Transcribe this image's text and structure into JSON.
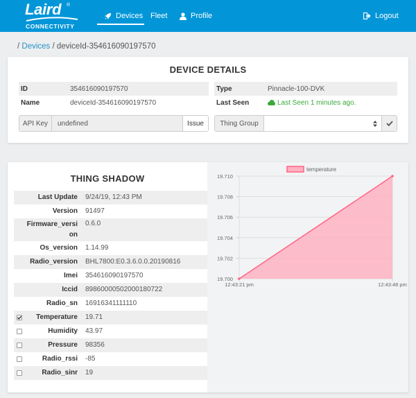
{
  "nav": {
    "brand": "Laird",
    "brand_sub": "CONNECTIVITY",
    "brand_reg": "®",
    "items": [
      {
        "label": "Devices",
        "icon": "rocket-icon"
      },
      {
        "label": "Fleet"
      },
      {
        "label": "Profile",
        "icon": "user-icon"
      }
    ],
    "logout": "Logout",
    "colors": {
      "bar": "#0296d8"
    }
  },
  "breadcrumb": {
    "sep": "/",
    "link": "Devices",
    "current": "deviceId-354616090197570"
  },
  "device_details": {
    "title": "DEVICE DETAILS",
    "id_label": "ID",
    "id_value": "354616090197570",
    "name_label": "Name",
    "name_value": "deviceId-354616090197570",
    "type_label": "Type",
    "type_value": "Pinnacle-100-DVK",
    "last_seen_label": "Last Seen",
    "last_seen_value": "Last Seen 1 minutes ago.",
    "api_key_label": "API Key",
    "api_key_value": "undefined",
    "issue_button": "Issue",
    "thing_group_label": "Thing Group",
    "thing_group_value": ""
  },
  "thing_shadow": {
    "title": "THING SHADOW",
    "rows": [
      {
        "key": "Last Update",
        "value": "9/24/19, 12:43 PM",
        "checkbox": null
      },
      {
        "key": "Version",
        "value": "91497",
        "checkbox": null
      },
      {
        "key": "Firmware_versi",
        "key2": "on",
        "value": "0.6.0",
        "checkbox": null
      },
      {
        "key": "Os_version",
        "value": "1.14.99",
        "checkbox": null
      },
      {
        "key": "Radio_version",
        "value": "BHL7800:E0.3.6.0.0.20190816",
        "checkbox": null
      },
      {
        "key": "Imei",
        "value": "354616090197570",
        "checkbox": null
      },
      {
        "key": "Iccid",
        "value": "89860000502000180722",
        "checkbox": null
      },
      {
        "key": "Radio_sn",
        "value": "16916341111110",
        "checkbox": null
      },
      {
        "key": "Temperature",
        "value": "19.71",
        "checkbox": true
      },
      {
        "key": "Humidity",
        "value": "43.97",
        "checkbox": false
      },
      {
        "key": "Pressure",
        "value": "98356",
        "checkbox": false
      },
      {
        "key": "Radio_rssi",
        "value": "-85",
        "checkbox": false
      },
      {
        "key": "Radio_sinr",
        "value": "19",
        "checkbox": false
      }
    ]
  },
  "chart_data": {
    "type": "area",
    "series": [
      {
        "name": "temperature",
        "x": [
          "12:43:21 pm",
          "12:43:48 pm"
        ],
        "values": [
          19.7,
          19.71
        ],
        "color": "#ff6384",
        "fill": "#ffb1c1"
      }
    ],
    "x_ticks": [
      "12:43:21 pm",
      "12:43:48 pm"
    ],
    "y_ticks": [
      "19.700",
      "19.702",
      "19.704",
      "19.706",
      "19.708",
      "19.710"
    ],
    "ylim": [
      19.7,
      19.71
    ],
    "grid": true,
    "legend": "top"
  }
}
